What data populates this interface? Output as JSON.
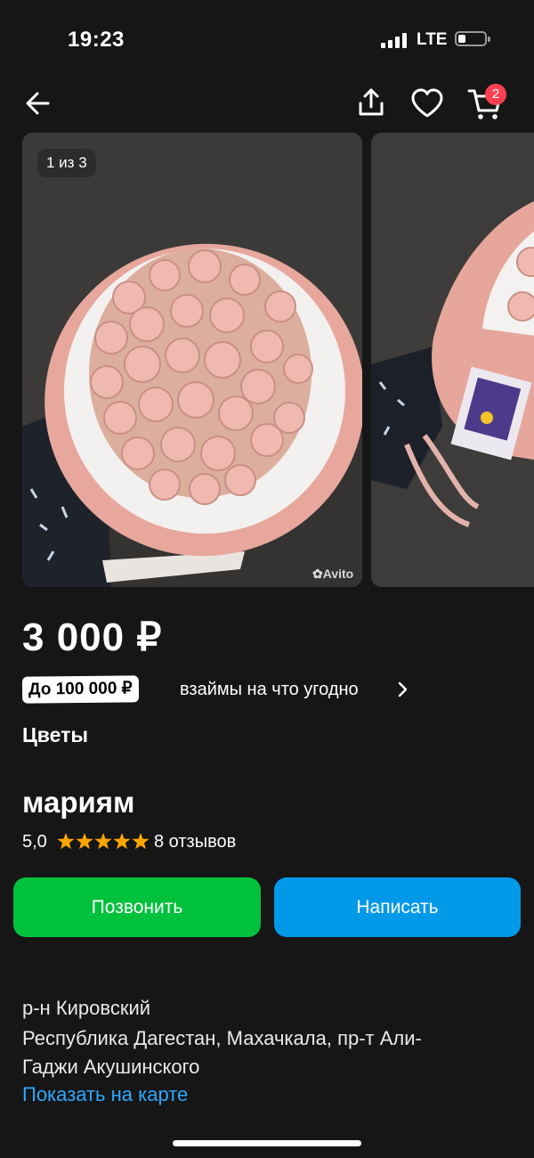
{
  "status_bar": {
    "time": "19:23",
    "network": "LTE"
  },
  "header": {
    "cart_count": "2"
  },
  "gallery": {
    "counter": "1 из 3",
    "watermark": "Avito"
  },
  "listing": {
    "price": "3 000 ₽",
    "loan_badge": "До 100 000 ₽",
    "loan_text": "взаймы на что угодно",
    "category": "Цветы"
  },
  "seller": {
    "name": "мариям",
    "rating": "5,0",
    "stars": 5,
    "reviews": "8 отзывов"
  },
  "actions": {
    "call": "Позвонить",
    "write": "Написать"
  },
  "address": {
    "district": "р-н Кировский",
    "line1": "Республика Дагестан, Махачкала, пр-т Али-",
    "line2": "Гаджи Акушинского",
    "map_link": "Показать на карте"
  },
  "colors": {
    "background": "#161616",
    "call_button": "#00c13b",
    "write_button": "#0099e8",
    "link": "#2ea8ff",
    "star": "#ffa500",
    "badge": "#ff4053"
  }
}
